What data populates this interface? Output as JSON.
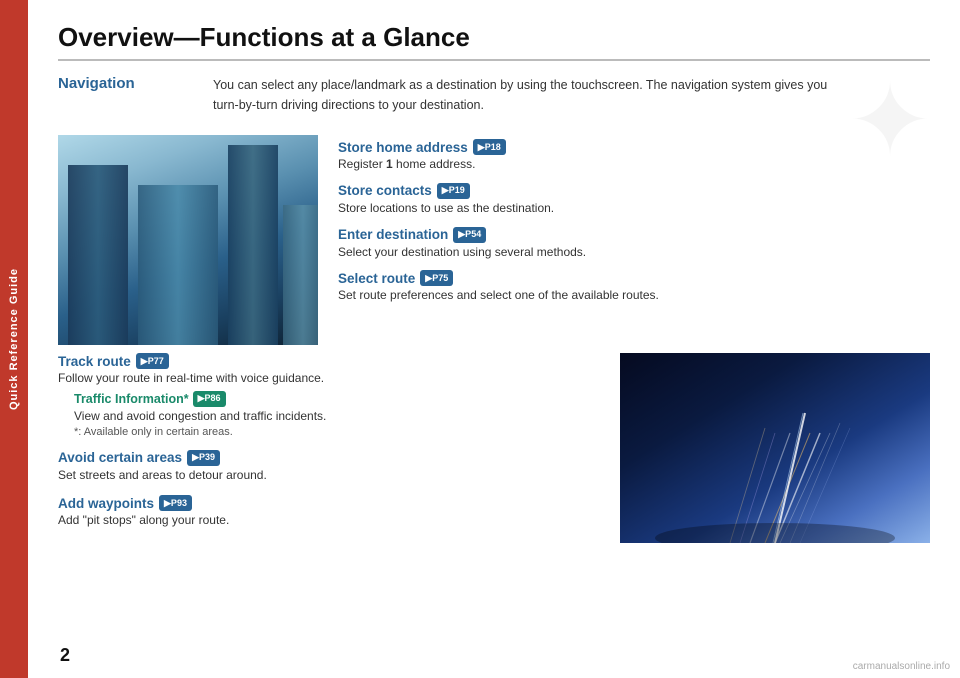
{
  "sidebar": {
    "label": "Quick Reference Guide"
  },
  "page": {
    "title": "Overview—Functions at a Glance",
    "number": "2"
  },
  "navigation": {
    "heading": "Navigation",
    "description_line1": "You can select any place/landmark as a destination by using the touchscreen. The navigation system gives you",
    "description_line2": "turn-by-turn driving directions to your destination."
  },
  "features_upper": [
    {
      "title": "Store home address",
      "badge": "▶P18",
      "description": "Register 1 home address.",
      "color": "blue"
    },
    {
      "title": "Store contacts",
      "badge": "▶P19",
      "description": "Store locations to use as the destination.",
      "color": "blue"
    },
    {
      "title": "Enter destination",
      "badge": "▶P54",
      "description": "Select your destination using several methods.",
      "color": "blue"
    },
    {
      "title": "Select route",
      "badge": "▶P75",
      "description": "Set route preferences and select one of the available routes.",
      "color": "blue"
    }
  ],
  "features_lower": [
    {
      "title": "Track route",
      "badge": "▶P77",
      "description": "Follow your route in real-time with voice guidance.",
      "color": "blue"
    },
    {
      "traffic": {
        "title": "Traffic Information*",
        "badge": "▶P86",
        "description": "View and avoid congestion and traffic incidents.",
        "note": "*: Available only in certain areas.",
        "color": "teal"
      }
    },
    {
      "title": "Avoid certain areas",
      "badge": "▶P39",
      "description": "Set streets and areas to detour around.",
      "color": "blue"
    },
    {
      "title": "Add waypoints",
      "badge": "▶P93",
      "description": "Add \"pit stops\" along your route.",
      "color": "blue"
    }
  ],
  "watermark": "carmanualsonline.info"
}
